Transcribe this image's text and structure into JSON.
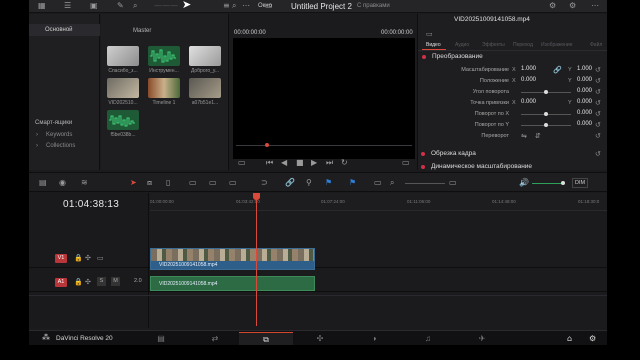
{
  "project": {
    "title": "Untitled Project 2",
    "state": "С правками"
  },
  "toolbar": {
    "window_label": "Окно"
  },
  "media_pool": {
    "main_tab": "Основной",
    "master_label": "Master",
    "smart_bins": "Смарт-ящики",
    "keywords": "Keywords",
    "collections": "Collections",
    "clips": [
      {
        "name": "Спасибо_з...",
        "kind": "video"
      },
      {
        "name": "Инструмен...",
        "kind": "audio"
      },
      {
        "name": "Доброго_у...",
        "kind": "video"
      },
      {
        "name": "VID202510...",
        "kind": "video"
      },
      {
        "name": "Timeline 1",
        "kind": "timeline"
      },
      {
        "name": "a07b51e1...",
        "kind": "video"
      },
      {
        "name": "f5be038b...",
        "kind": "audio"
      }
    ]
  },
  "viewer": {
    "timecode_left": "00:00:00:00",
    "timecode_right": "00:00:00:00"
  },
  "inspector": {
    "clip_name": "VID20251009141058.mp4",
    "tabs": [
      "Видео",
      "Аудио",
      "Эффекты",
      "Переход",
      "Изображение",
      "Файл"
    ],
    "active_tab": "Видео",
    "section_transform": "Преобразование",
    "params": [
      {
        "label": "Масштабирование",
        "x": "1.000",
        "y": "1.000"
      },
      {
        "label": "Положение",
        "x": "0.000",
        "y": "0.000"
      },
      {
        "label": "Угол поворота",
        "x": "0.000",
        "y": ""
      },
      {
        "label": "Точка привязки",
        "x": "0.000",
        "y": "0.000"
      },
      {
        "label": "Поворот по X",
        "x": "0.000",
        "y": ""
      },
      {
        "label": "Поворот по Y",
        "x": "0.000",
        "y": ""
      },
      {
        "label": "Переворот",
        "x": "",
        "y": ""
      }
    ],
    "axis_x": "X",
    "axis_y": "Y",
    "section_crop": "Обрезка кадра",
    "section_dynamic": "Динамическое масштабирование"
  },
  "timeline": {
    "timecode": "01:04:38:13",
    "ruler": [
      "01:00:00:00",
      "01:03:42:00",
      "01:07:24:00",
      "01:11:06:00",
      "01:14:48:00",
      "01:18:30:0"
    ],
    "tracks": [
      {
        "id": "V1",
        "color": "#b8353a"
      },
      {
        "id": "A1",
        "color": "#b8353a",
        "level": "2.0",
        "mute": "M",
        "solo": "S"
      }
    ],
    "clip_video": "VID20251009141058.mp4",
    "clip_audio": "VID20251009141058.mp4",
    "audio_readout": "DIM"
  },
  "bottom": {
    "brand": "DaVinci Resolve 20",
    "pages": [
      "▤",
      "⇄",
      "⧉",
      "✣",
      "◑",
      "♫",
      "✈"
    ]
  }
}
